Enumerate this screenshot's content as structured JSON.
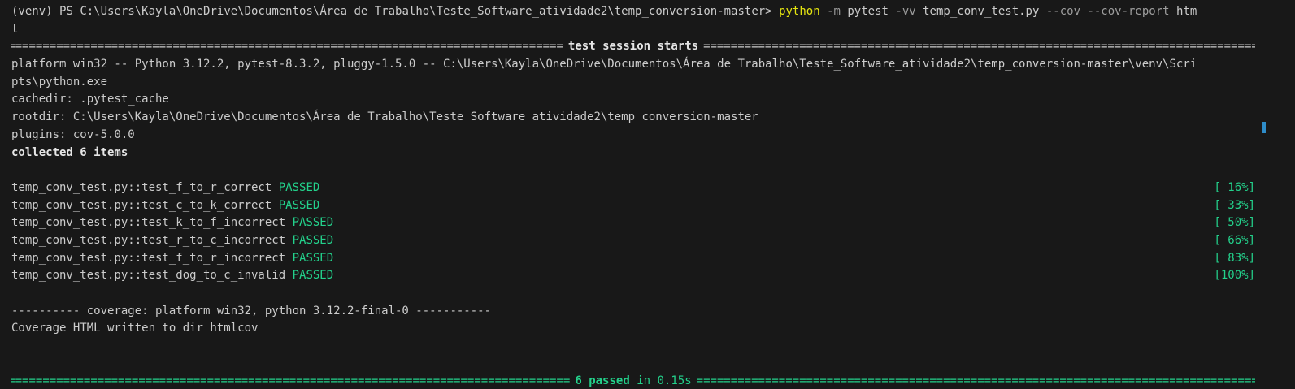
{
  "terminal": {
    "prompt": {
      "venv": "(venv)",
      "ps": "PS",
      "path": "C:\\Users\\Kayla\\OneDrive\\Documentos\\Área de Trabalho\\Teste_Software_atividade2\\temp_conversion-master>",
      "command": "python",
      "flag_m": "-m",
      "module": "pytest",
      "flag_vv": "-vv",
      "file": "temp_conv_test.py",
      "flag_cov": "--cov",
      "flag_report": "--cov-report",
      "report_arg_a": "htm",
      "report_arg_b": "l"
    },
    "session_title": "test session starts",
    "platform_line_1": "platform win32 -- Python 3.12.2, pytest-8.3.2, pluggy-1.5.0 -- C:\\Users\\Kayla\\OneDrive\\Documentos\\Área de Trabalho\\Teste_Software_atividade2\\temp_conversion-master\\venv\\Scri",
    "platform_line_2": "pts\\python.exe",
    "cachedir": "cachedir: .pytest_cache",
    "rootdir": "rootdir: C:\\Users\\Kayla\\OneDrive\\Documentos\\Área de Trabalho\\Teste_Software_atividade2\\temp_conversion-master",
    "plugins": "plugins: cov-5.0.0",
    "collected": "collected 6 items",
    "tests": [
      {
        "name": "temp_conv_test.py::test_f_to_r_correct",
        "status": "PASSED",
        "progress": "[ 16%]"
      },
      {
        "name": "temp_conv_test.py::test_c_to_k_correct",
        "status": "PASSED",
        "progress": "[ 33%]"
      },
      {
        "name": "temp_conv_test.py::test_k_to_f_incorrect",
        "status": "PASSED",
        "progress": "[ 50%]"
      },
      {
        "name": "temp_conv_test.py::test_r_to_c_incorrect",
        "status": "PASSED",
        "progress": "[ 66%]"
      },
      {
        "name": "temp_conv_test.py::test_f_to_r_incorrect",
        "status": "PASSED",
        "progress": "[ 83%]"
      },
      {
        "name": "temp_conv_test.py::test_dog_to_c_invalid",
        "status": "PASSED",
        "progress": "[100%]"
      }
    ],
    "coverage_header": "---------- coverage: platform win32, python 3.12.2-final-0 -----------",
    "coverage_written": "Coverage HTML written to dir htmlcov",
    "summary_passed": "6 passed",
    "summary_time": "in 0.15s",
    "separator_char": "=",
    "dash_char": "-"
  },
  "colors": {
    "background": "#181818",
    "text": "#cccccc",
    "prompt_command": "#e5e510",
    "args": "#9d9d9d",
    "passed": "#23d18b",
    "scroll_marker": "#2e8cc8"
  }
}
